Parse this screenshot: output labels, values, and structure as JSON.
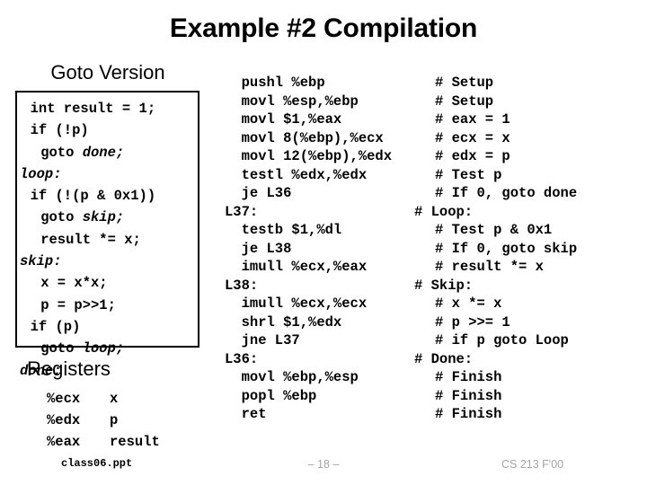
{
  "slide": {
    "title": "Example #2 Compilation",
    "accent_color": "#000000",
    "background_color": "#ffffff",
    "footer_color": "#a6a6a6"
  },
  "left_panel": {
    "heading": "Goto Version",
    "code_lines": [
      {
        "indent": 1,
        "text": "int result = 1;",
        "italic_tail": ""
      },
      {
        "indent": 1,
        "text": "if (!p)",
        "italic_tail": ""
      },
      {
        "indent": 2,
        "text": "goto ",
        "italic_tail": "done;"
      },
      {
        "indent": 0,
        "text": "",
        "italic_tail": "loop:"
      },
      {
        "indent": 1,
        "text": "if (!(p & 0x1))",
        "italic_tail": ""
      },
      {
        "indent": 2,
        "text": "goto ",
        "italic_tail": "skip;"
      },
      {
        "indent": 2,
        "text": "result *= x;",
        "italic_tail": ""
      },
      {
        "indent": 0,
        "text": "",
        "italic_tail": "skip:"
      },
      {
        "indent": 2,
        "text": "x = x*x;",
        "italic_tail": ""
      },
      {
        "indent": 2,
        "text": "p = p>>1;",
        "italic_tail": ""
      },
      {
        "indent": 1,
        "text": "if (p)",
        "italic_tail": ""
      },
      {
        "indent": 2,
        "text": "goto ",
        "italic_tail": "loop;"
      },
      {
        "indent": 0,
        "text": "",
        "italic_tail": "done:"
      }
    ]
  },
  "registers": {
    "heading": "Registers",
    "rows": [
      {
        "name": "%ecx",
        "value": "x"
      },
      {
        "name": "%edx",
        "value": "p"
      },
      {
        "name": "%eax",
        "value": "result"
      }
    ]
  },
  "assembly": {
    "lines": [
      {
        "is_label": false,
        "code": "  pushl %ebp",
        "comment": "# Setup"
      },
      {
        "is_label": false,
        "code": "  movl %esp,%ebp",
        "comment": "# Setup"
      },
      {
        "is_label": false,
        "code": "  movl $1,%eax",
        "comment": "# eax = 1"
      },
      {
        "is_label": false,
        "code": "  movl 8(%ebp),%ecx",
        "comment": "# ecx = x"
      },
      {
        "is_label": false,
        "code": "  movl 12(%ebp),%edx",
        "comment": "# edx = p"
      },
      {
        "is_label": false,
        "code": "  testl %edx,%edx",
        "comment": "# Test p"
      },
      {
        "is_label": false,
        "code": "  je L36",
        "comment": "# If 0, goto done"
      },
      {
        "is_label": true,
        "code": "L37:",
        "comment": "# Loop:"
      },
      {
        "is_label": false,
        "code": "  testb $1,%dl",
        "comment": "# Test p & 0x1"
      },
      {
        "is_label": false,
        "code": "  je L38",
        "comment": "# If 0, goto skip"
      },
      {
        "is_label": false,
        "code": "  imull %ecx,%eax",
        "comment": "# result *= x"
      },
      {
        "is_label": true,
        "code": "L38:",
        "comment": "# Skip:"
      },
      {
        "is_label": false,
        "code": "  imull %ecx,%ecx",
        "comment": "# x *= x"
      },
      {
        "is_label": false,
        "code": "  shrl $1,%edx",
        "comment": "# p >>= 1"
      },
      {
        "is_label": false,
        "code": "  jne L37",
        "comment": "# if p goto Loop"
      },
      {
        "is_label": true,
        "code": "L36:",
        "comment": "# Done:"
      },
      {
        "is_label": false,
        "code": "  movl %ebp,%esp",
        "comment": "# Finish"
      },
      {
        "is_label": false,
        "code": "  popl %ebp",
        "comment": "# Finish"
      },
      {
        "is_label": false,
        "code": "  ret",
        "comment": "# Finish"
      }
    ]
  },
  "footer": {
    "file": "class06.ppt",
    "page": "– 18 –",
    "course": "CS 213 F'00"
  }
}
